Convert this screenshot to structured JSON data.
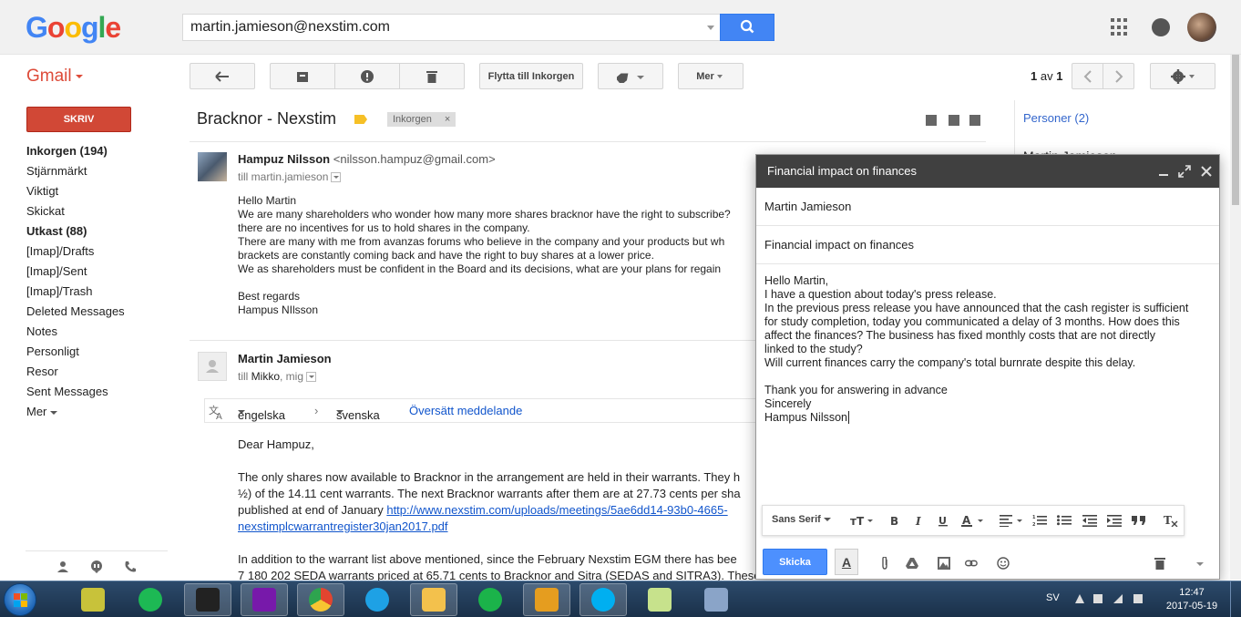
{
  "header": {
    "logo_letters": [
      "G",
      "o",
      "o",
      "g",
      "l",
      "e"
    ],
    "logo_colors": [
      "#4285f4",
      "#ea4335",
      "#fbbc05",
      "#4285f4",
      "#34a853",
      "#ea4335"
    ],
    "search_value": "martin.jamieson@nexstim.com"
  },
  "toolbar": {
    "app_label": "Gmail",
    "move_to_inbox": "Flytta till Inkorgen",
    "more": "Mer",
    "pager_current": "1",
    "pager_of": "av",
    "pager_total": "1"
  },
  "sidebar": {
    "compose": "SKRIV",
    "items": [
      {
        "label": "Inkorgen (194)",
        "bold": true
      },
      {
        "label": "Stjärnmärkt",
        "bold": false
      },
      {
        "label": "Viktigt",
        "bold": false
      },
      {
        "label": "Skickat",
        "bold": false
      },
      {
        "label": "Utkast (88)",
        "bold": true
      },
      {
        "label": "[Imap]/Drafts",
        "bold": false
      },
      {
        "label": "[Imap]/Sent",
        "bold": false
      },
      {
        "label": "[Imap]/Trash",
        "bold": false
      },
      {
        "label": "Deleted Messages",
        "bold": false
      },
      {
        "label": "Notes",
        "bold": false
      },
      {
        "label": "Personligt",
        "bold": false
      },
      {
        "label": "Resor",
        "bold": false
      },
      {
        "label": "Sent Messages",
        "bold": false
      },
      {
        "label": "Mer",
        "bold": false
      }
    ]
  },
  "thread": {
    "subject": "Bracknor - Nexstim",
    "inbox_chip": "Inkorgen",
    "chip_close": "×",
    "message1": {
      "sender": "Hampuz Nilsson",
      "email": "<nilsson.hampuz@gmail.com>",
      "to": "till martin.jamieson",
      "lines": [
        "Hello Martin",
        "We are many shareholders who wonder how many more shares bracknor have the right to subscribe?",
        "there are no incentives for us to hold shares in the company.",
        "There are many with me from avanzas forums who believe in the company and your products but wh",
        "brackets are constantly coming back and have the right to buy shares at a lower price.",
        "We as shareholders must be confident in the Board and its decisions, what are your plans for regain",
        "",
        "Best regards",
        "Hampus NIlsson"
      ]
    },
    "message2": {
      "sender": "Martin Jamieson",
      "to_prefix": "till ",
      "to_names": "Mikko",
      "to_suffix": ", mig",
      "translate_from": "engelska",
      "translate_arrow": "›",
      "translate_to": "svenska",
      "translate_action": "Översätt meddelande",
      "greeting": "Dear Hampuz,",
      "para1": [
        "The only shares now available to Bracknor in the arrangement are held in their warrants. They h",
        "½) of the 14.11 cent warrants. The next Bracknor warrants after them are at 27.73 cents per sha",
        "published at end of January "
      ],
      "link1": "http://www.nexstim.com/uploads/meetings/5ae6dd14-93b0-4665-",
      "link2": "nexstimplcwarrantregister30jan2017.pdf",
      "para2": [
        "In addition to the warrant list above mentioned, since the February Nexstim EGM there has bee",
        "7 180 202 SEDA warrants priced at 65.71 cents to Bracknor and Sitra (SEDAS and SITRA3). These"
      ]
    }
  },
  "right_panel": {
    "people": "Personer (2)",
    "contact_partial": "Martin Jamieson"
  },
  "compose": {
    "title": "Financial impact on finances",
    "to": "Martin Jamieson",
    "subject": "Financial impact on finances",
    "body_lines": [
      "Hello Martin,",
      "I have a question about today's press release.",
      "In the previous press release you have announced that the cash register is sufficient",
      "for study completion, today you communicated a delay of 3 months. How does this",
      "affect the finances? The business has fixed monthly costs that are not directly",
      "linked to the study?",
      "Will current finances carry the company's total burnrate despite this delay.",
      "",
      "Thank you for answering in advance",
      "Sincerely",
      "Hampus Nilsson"
    ],
    "font": "Sans Serif",
    "send": "Skicka",
    "fmt_toggle": "A"
  },
  "taskbar": {
    "language": "SV",
    "time": "12:47",
    "date": "2017-05-19",
    "apps": [
      {
        "name": "keepass",
        "color": "#c8c23a"
      },
      {
        "name": "spotify",
        "color": "#1db954"
      },
      {
        "name": "sonos",
        "color": "#222222"
      },
      {
        "name": "onenote",
        "color": "#7719aa"
      },
      {
        "name": "chrome",
        "color": "#e2452f"
      },
      {
        "name": "ie",
        "color": "#1ea1e5"
      },
      {
        "name": "explorer",
        "color": "#f3c14c"
      },
      {
        "name": "chat",
        "color": "#1bb34a"
      },
      {
        "name": "outlook",
        "color": "#e59d1f"
      },
      {
        "name": "skype",
        "color": "#00aff0"
      },
      {
        "name": "notes",
        "color": "#c7e28c"
      },
      {
        "name": "paint",
        "color": "#8aa4c8"
      }
    ]
  }
}
